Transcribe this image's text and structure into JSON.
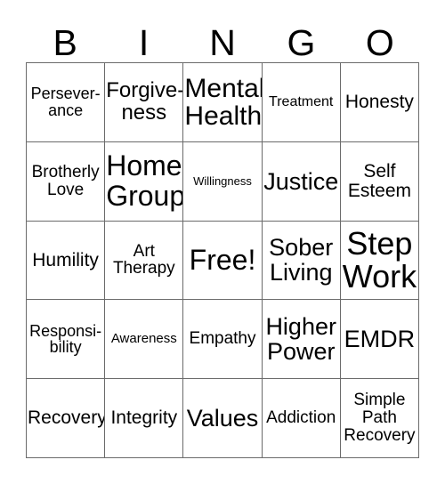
{
  "card": {
    "title": "Bingo Card",
    "header_letters": [
      "B",
      "I",
      "N",
      "G",
      "O"
    ],
    "border_color": "#6b6b6b",
    "background_color": "#ffffff",
    "text_color": "#000000",
    "rows": 5,
    "columns": 5,
    "free_space": "Free!",
    "cells": [
      [
        {
          "text": "Persever-\nance",
          "size": "fs-md"
        },
        {
          "text": "Forgive-\nness",
          "size": "fs-xl"
        },
        {
          "text": "Mental\nHealth",
          "size": "fs-3xl"
        },
        {
          "text": "Treatment",
          "size": "fs-smp"
        },
        {
          "text": "Honesty",
          "size": "fs-lg"
        }
      ],
      [
        {
          "text": "Brotherly\nLove",
          "size": "fs-md2"
        },
        {
          "text": "Home\nGroup",
          "size": "fs-4xl"
        },
        {
          "text": "Willingness",
          "size": "fs-xs"
        },
        {
          "text": "Justice",
          "size": "fs-2xl"
        },
        {
          "text": "Self\nEsteem",
          "size": "fs-lg"
        }
      ],
      [
        {
          "text": "Humility",
          "size": "fs-lg"
        },
        {
          "text": "Art\nTherapy",
          "size": "fs-md2"
        },
        {
          "text": "Free!",
          "size": "fs-4xl"
        },
        {
          "text": "Sober\nLiving",
          "size": "fs-2xl"
        },
        {
          "text": "Step\nWork",
          "size": "fs-5xl"
        }
      ],
      [
        {
          "text": "Responsi-\nbility",
          "size": "fs-md"
        },
        {
          "text": "Awareness",
          "size": "fs-sm"
        },
        {
          "text": "Empathy",
          "size": "fs-md2"
        },
        {
          "text": "Higher\nPower",
          "size": "fs-2xl"
        },
        {
          "text": "EMDR",
          "size": "fs-2xl"
        }
      ],
      [
        {
          "text": "Recovery",
          "size": "fs-lg"
        },
        {
          "text": "Integrity",
          "size": "fs-lg"
        },
        {
          "text": "Values",
          "size": "fs-2xl"
        },
        {
          "text": "Addiction",
          "size": "fs-md2"
        },
        {
          "text": "Simple\nPath\nRecovery",
          "size": "fs-md2"
        }
      ]
    ]
  }
}
